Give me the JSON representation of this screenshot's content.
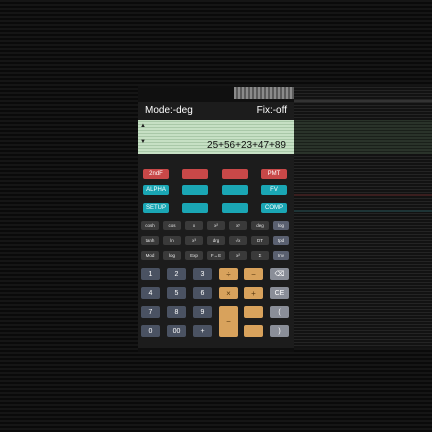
{
  "app": {
    "mode_label": "Mode:-deg",
    "fix_label": "Fix:-off",
    "expression": "25+56+23+47+89",
    "up_arrow": "▲",
    "down_arrow": "▼"
  },
  "row_red": [
    "2ndF",
    "",
    "",
    "PMT"
  ],
  "row_teal1": [
    "ALPHA",
    "",
    "",
    "FV"
  ],
  "row_teal2": [
    "SETUP",
    "",
    "",
    "COMP"
  ],
  "sci_row1": [
    "cosh",
    "cos",
    "x",
    "x²",
    "xʸ",
    "deg",
    "log"
  ],
  "sci_row2": [
    "tanh",
    "ln",
    "x³",
    "drg",
    "√x",
    "DT",
    "tpd"
  ],
  "sci_row3": [
    "Mod",
    "log",
    "Exp",
    "F↔E",
    "x²",
    "Σ",
    "Inv"
  ],
  "keypad": {
    "col1": [
      "1",
      "4",
      "7",
      "0"
    ],
    "col2": [
      "2",
      "5",
      "8",
      "00"
    ],
    "col3": [
      "3",
      "6",
      "9",
      "+"
    ],
    "op1": [
      "÷",
      "×",
      "−",
      ""
    ],
    "op2": [
      "−",
      "+",
      "",
      ""
    ],
    "right": [
      "⌫",
      "CE",
      "(",
      ")"
    ]
  },
  "colors": {
    "red": "#c84848",
    "teal": "#1aa6b4",
    "orange": "#d8a25c",
    "display": "#c6e0c4"
  }
}
